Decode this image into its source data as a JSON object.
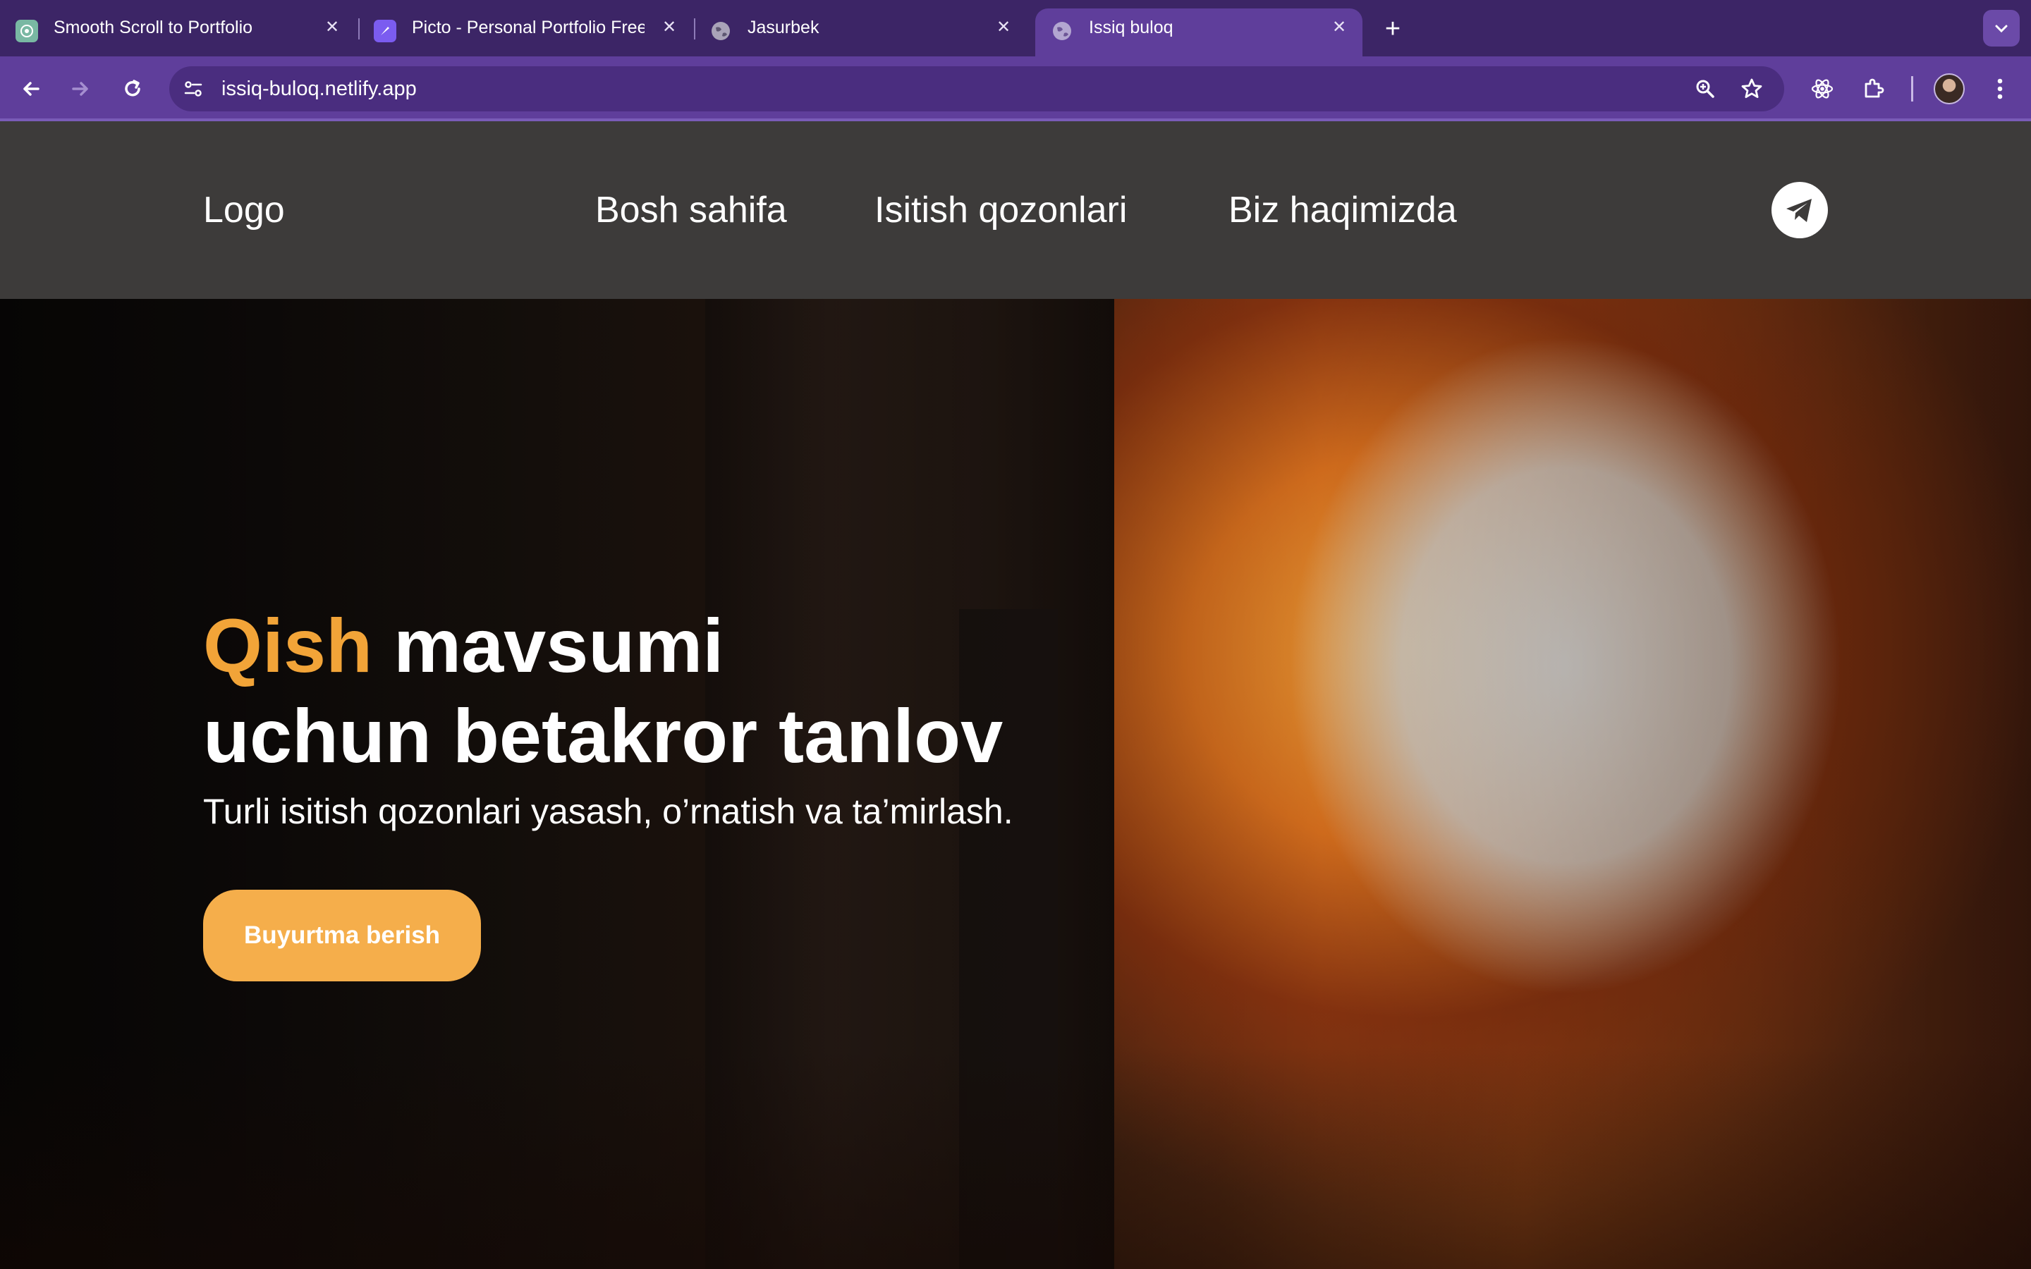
{
  "browser": {
    "tabs": [
      {
        "title": "Smooth Scroll to Portfolio",
        "favicon": "chatgpt-icon",
        "active": false
      },
      {
        "title": "Picto - Personal Portfolio Free",
        "favicon": "feather-icon",
        "active": false
      },
      {
        "title": "Jasurbek",
        "favicon": "globe-icon",
        "active": false
      },
      {
        "title": "Issiq buloq",
        "favicon": "globe-icon",
        "active": true
      }
    ],
    "url": "issiq-buloq.netlify.app"
  },
  "site": {
    "logo": "Logo",
    "nav": [
      "Bosh sahifa",
      "Isitish qozonlari",
      "Biz haqimizda"
    ],
    "social_icon": "telegram-icon"
  },
  "hero": {
    "title_accent": "Qish",
    "title_rest_line1": "mavsumi",
    "title_line2": "uchun betakror tanlov",
    "subtitle": "Turli isitish qozonlari yasash, o’rnatish va ta’mirlash.",
    "cta_label": "Buyurtma berish"
  },
  "colors": {
    "accent": "#f2a438",
    "cta_background": "#f5ae4b",
    "header_background": "#3d3b3a",
    "browser_frame": "#5f3e9b"
  }
}
